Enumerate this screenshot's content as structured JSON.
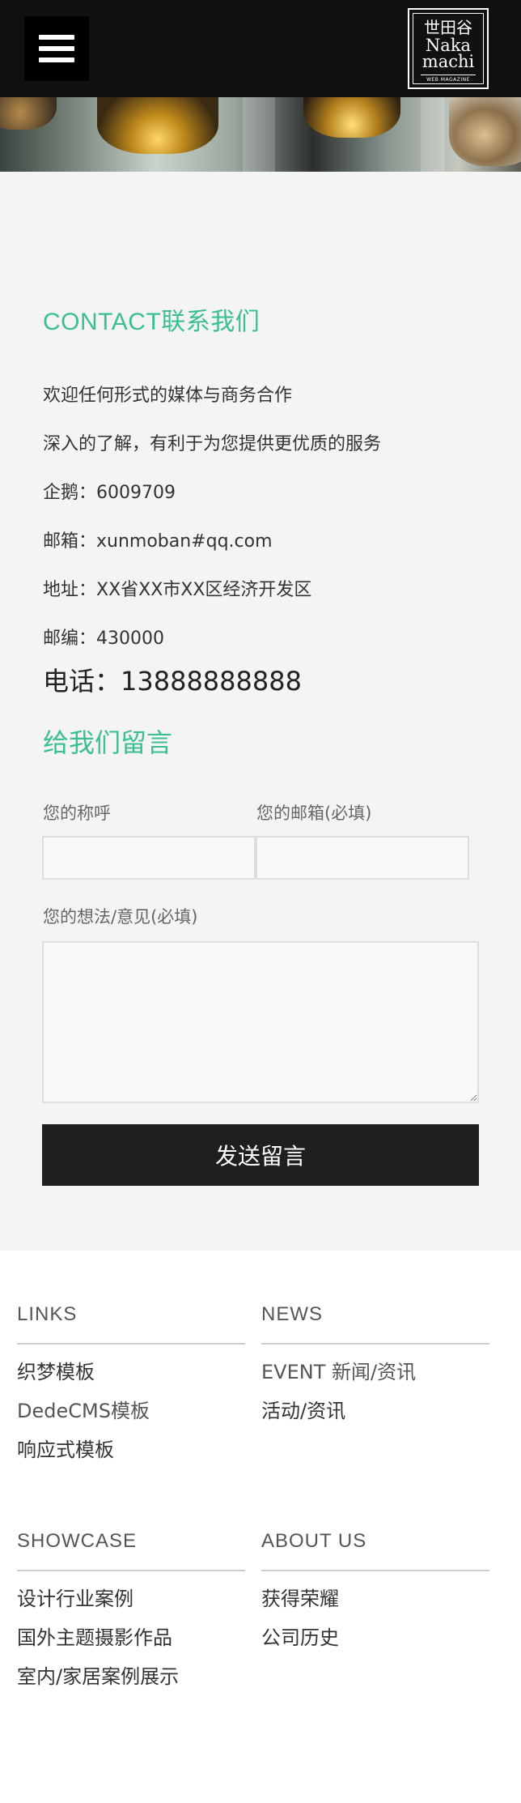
{
  "header": {
    "menu_icon": "hamburger-menu-icon",
    "logo": {
      "kanji": "世田谷",
      "line1": "Naka",
      "line2": "machi",
      "tagline": "WEB MAGAZINE"
    }
  },
  "contact": {
    "title": "CONTACT联系我们",
    "lines": {
      "welcome": "欢迎任何形式的媒体与商务合作",
      "understand": "深入的了解，有利于为您提供更优质的服务",
      "qq": "企鹅：6009709",
      "email": "邮箱：xunmoban#qq.com",
      "address": "地址：XX省XX市XX区经济开发区",
      "zip": "邮编：430000",
      "phone": "电话：13888888888"
    }
  },
  "form": {
    "title": "给我们留言",
    "name_label": "您的称呼",
    "name_value": "",
    "email_label": "您的邮箱(必填)",
    "email_value": "",
    "message_label": "您的想法/意见(必填)",
    "message_value": "",
    "submit_label": "发送留言"
  },
  "footer": {
    "links": {
      "heading": "LINKS",
      "items": [
        "织梦模板",
        "DedeCMS模板",
        "响应式模板"
      ]
    },
    "news": {
      "heading": "NEWS",
      "items": [
        "EVENT 新闻/资讯",
        "活动/资讯"
      ]
    },
    "showcase": {
      "heading": "SHOWCASE",
      "items": [
        "设计行业案例",
        "国外主题摄影作品",
        "室内/家居案例展示"
      ]
    },
    "about": {
      "heading": "ABOUT US",
      "items": [
        "获得荣耀",
        "公司历史"
      ]
    }
  },
  "colors": {
    "accent": "#3cbf8f",
    "header_bg": "#111111",
    "button_bg": "#1f1f1f",
    "section_bg": "#f4f4f4"
  }
}
